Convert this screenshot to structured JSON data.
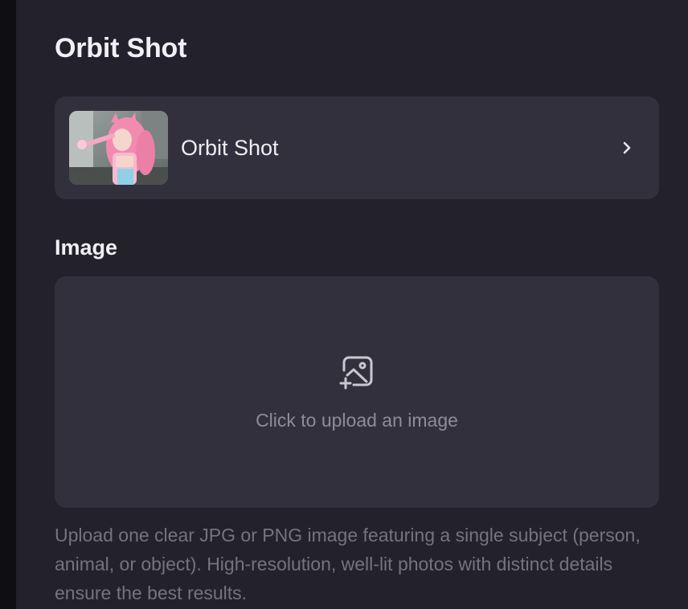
{
  "page": {
    "title": "Orbit Shot"
  },
  "template_card": {
    "name": "Orbit Shot",
    "thumbnail_icon": "pink-haired-character-thumbnail",
    "chevron_icon": "chevron-right-icon"
  },
  "image_section": {
    "label": "Image",
    "upload_icon": "image-add-icon",
    "upload_text": "Click to upload an image",
    "help_text": "Upload one clear JPG or PNG image featuring a single subject (person, animal, or object). High-resolution, well-lit photos with distinct details ensure the best results."
  },
  "colors": {
    "panel_background": "#23212c",
    "card_background": "#32303d",
    "sidebar_strip": "#0f0e13",
    "primary_text": "#f1f0f5",
    "muted_text": "#8e8c99"
  }
}
